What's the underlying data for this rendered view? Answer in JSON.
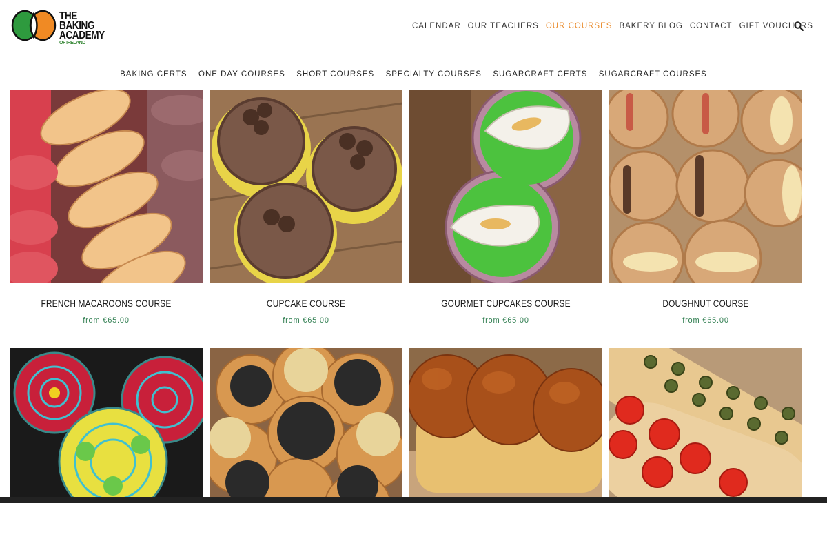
{
  "brand": {
    "line1": "THE BAKING",
    "line2": "ACADEMY",
    "line3": "OF IRELAND",
    "colors": {
      "green": "#2e9a3e",
      "orange": "#f08a24",
      "white": "#ffffff"
    }
  },
  "main_nav": [
    {
      "label": "CALENDAR"
    },
    {
      "label": "OUR TEACHERS"
    },
    {
      "label": "OUR COURSES",
      "active": true
    },
    {
      "label": "BAKERY BLOG"
    },
    {
      "label": "CONTACT"
    },
    {
      "label": "GIFT VOUCHERS"
    }
  ],
  "search": {
    "icon": "search-icon"
  },
  "sub_nav": [
    {
      "label": "BAKING CERTS"
    },
    {
      "label": "ONE DAY COURSES"
    },
    {
      "label": "SHORT COURSES"
    },
    {
      "label": "SPECIALTY COURSES"
    },
    {
      "label": "SUGARCRAFT CERTS"
    },
    {
      "label": "SUGARCRAFT COURSES"
    }
  ],
  "courses": [
    {
      "title": "FRENCH MACAROONS COURSE",
      "price": "from €65.00",
      "image": "macarons-photo"
    },
    {
      "title": "CUPCAKE COURSE",
      "price": "from €65.00",
      "image": "chocolate-cupcakes-photo"
    },
    {
      "title": "GOURMET CUPCAKES COURSE",
      "price": "from €65.00",
      "image": "calla-lily-cupcakes-photo"
    },
    {
      "title": "DOUGHNUT COURSE",
      "price": "from €65.00",
      "image": "doughnuts-photo"
    },
    {
      "image": "decorated-cookies-photo"
    },
    {
      "image": "seeded-bread-rolls-photo"
    },
    {
      "image": "brioche-loaf-photo"
    },
    {
      "image": "focaccia-photo"
    }
  ],
  "accent_color": "#e98a2a",
  "price_color": "#2e7d4f"
}
